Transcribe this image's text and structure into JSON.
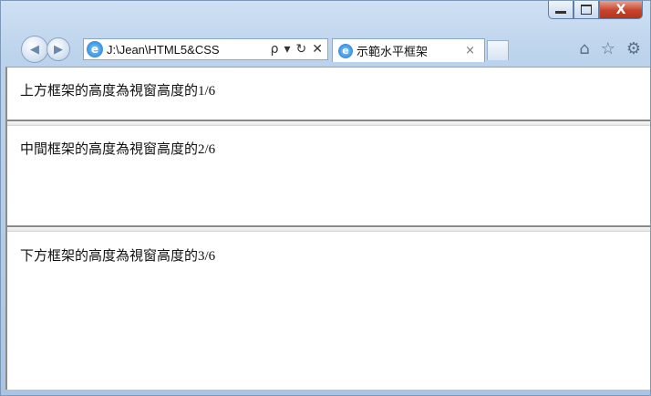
{
  "window": {
    "close_glyph": "X"
  },
  "nav": {
    "address": "J:\\Jean\\HTML5&CSS",
    "search_glyph": "ρ",
    "dropdown_glyph": "▾",
    "refresh_glyph": "↻",
    "stop_glyph": "✕"
  },
  "tab": {
    "title": "示範水平框架",
    "close_glyph": "×"
  },
  "frames": {
    "top": "上方框架的高度為視窗高度的1/6",
    "middle": "中間框架的高度為視窗高度的2/6",
    "bottom": "下方框架的高度為視窗高度的3/6"
  }
}
